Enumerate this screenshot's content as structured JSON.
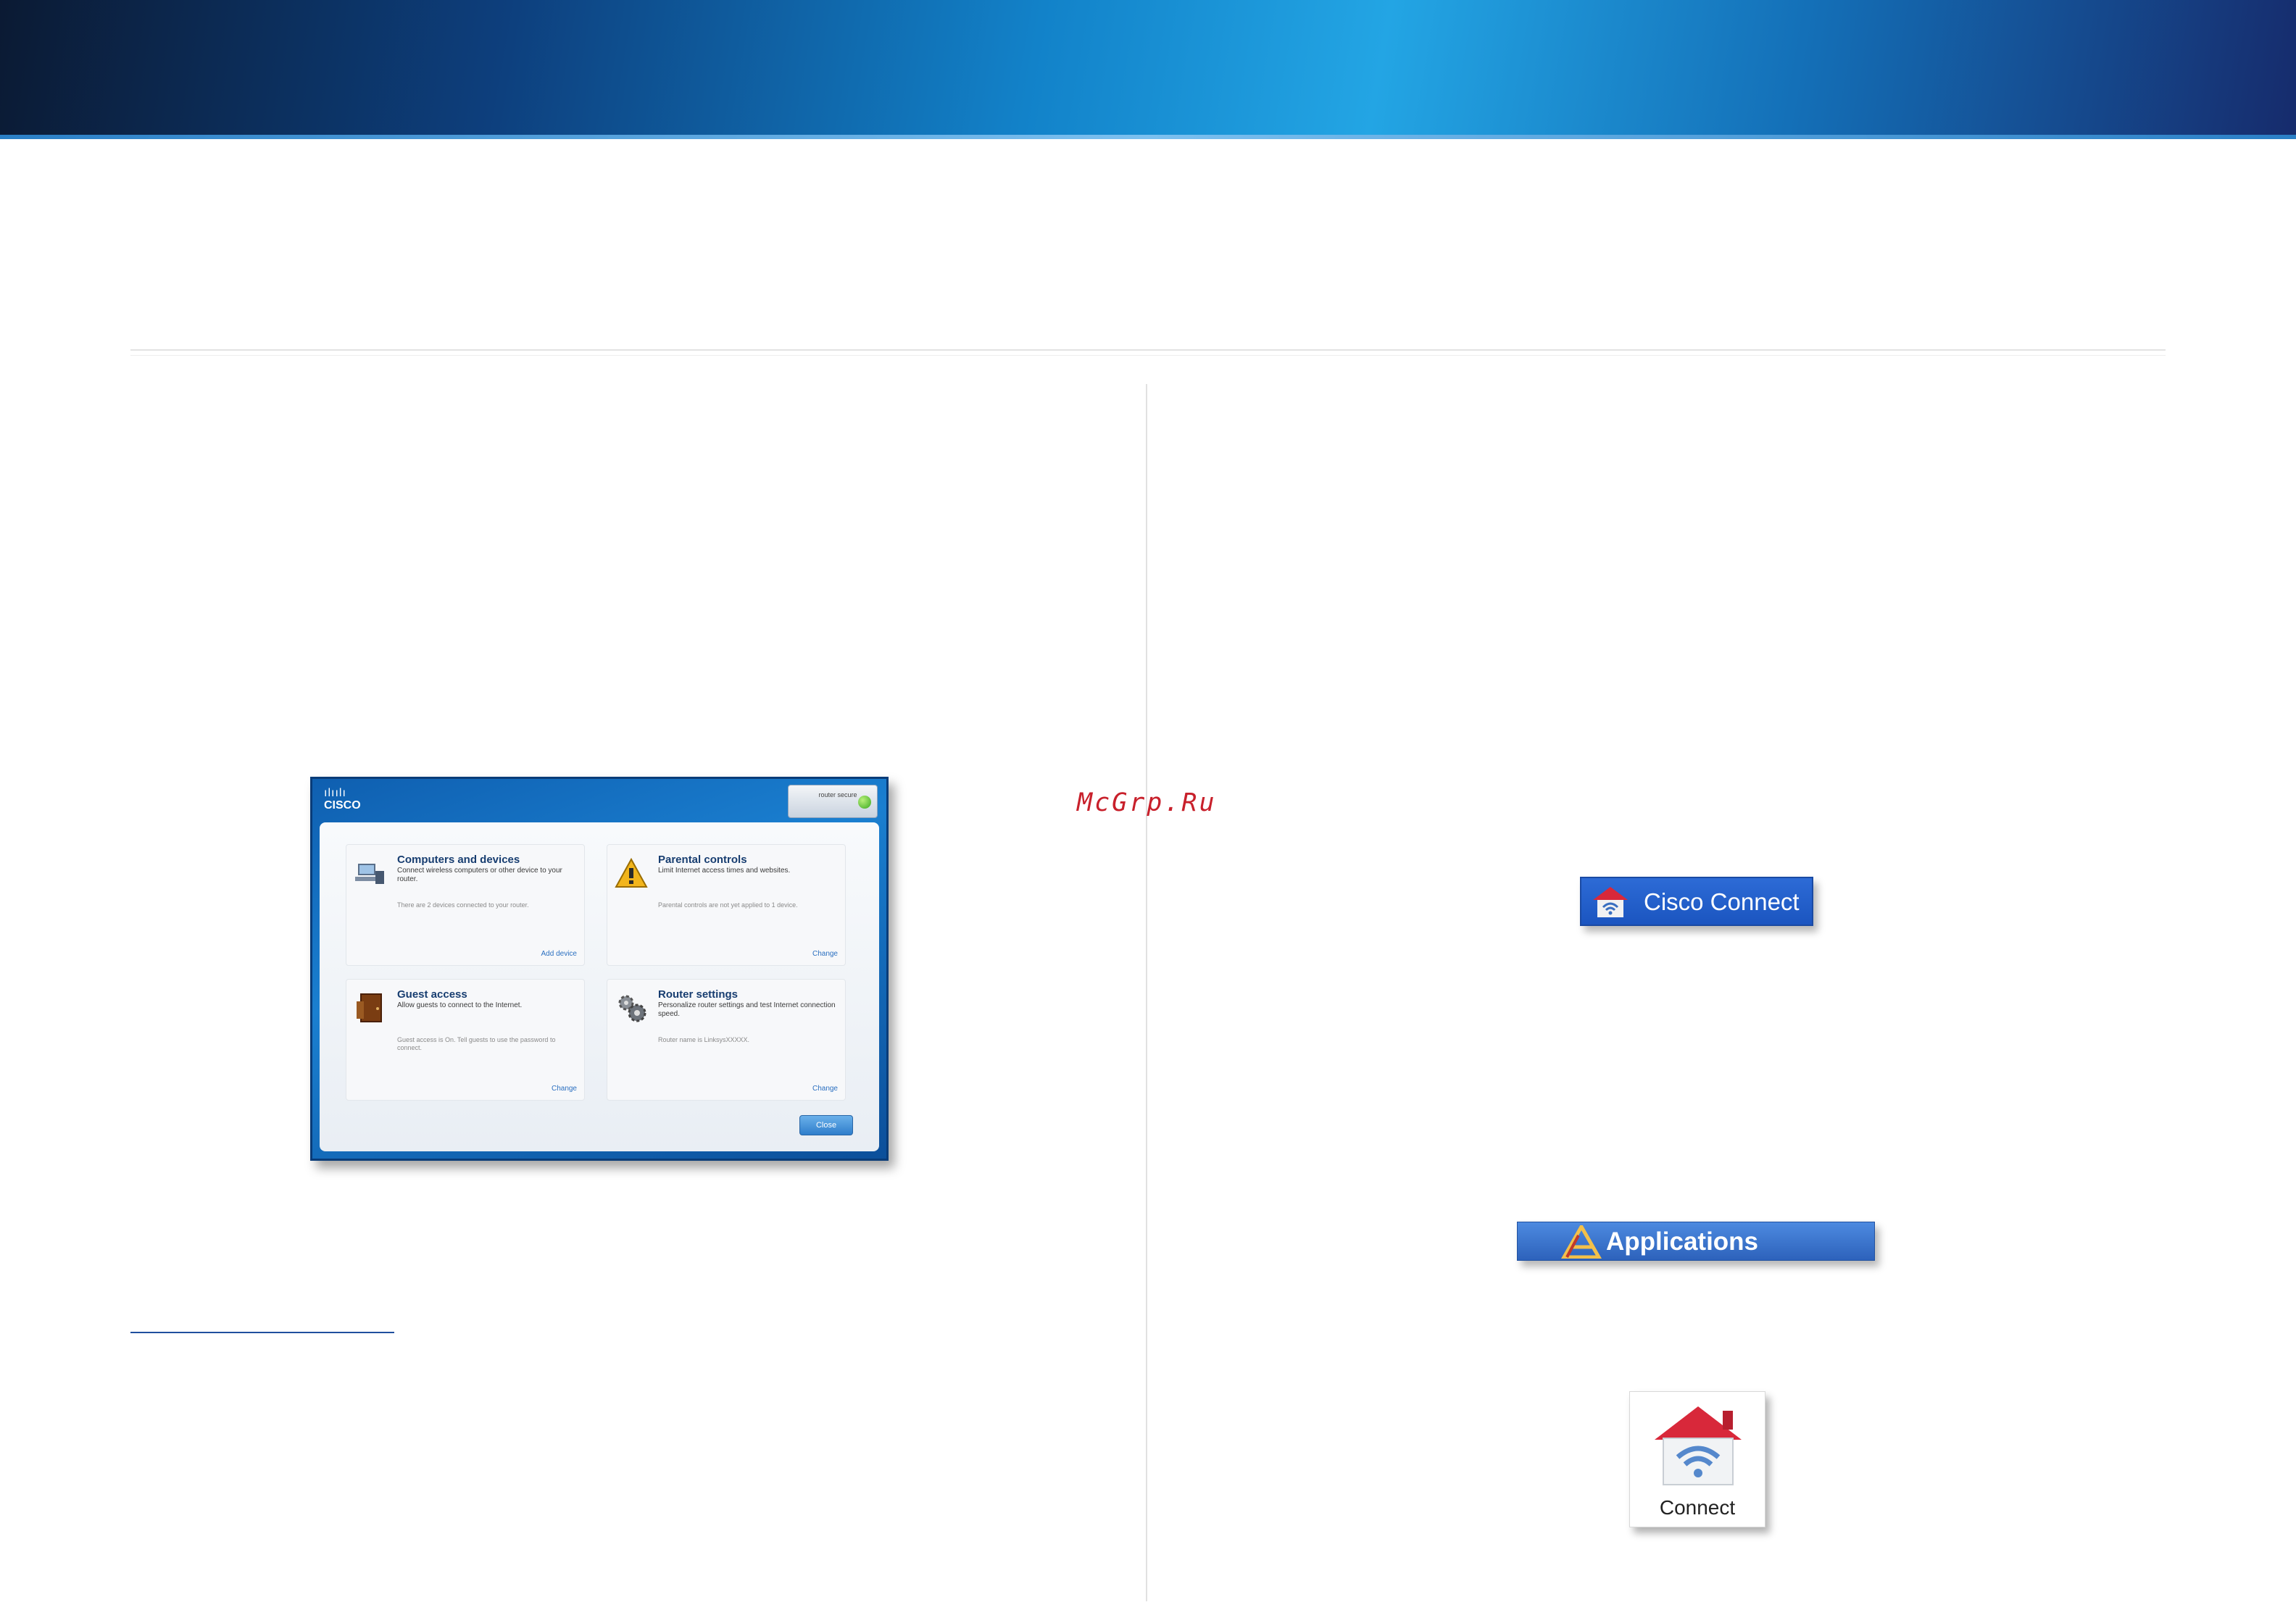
{
  "watermark": "McGrp.Ru",
  "dashboard": {
    "logo_bars": "ılıılı",
    "logo_word": "CISCO",
    "status_text": "router secure",
    "cards": [
      {
        "title": "Computers and devices",
        "desc": "Connect wireless computers or other device to your router.",
        "note": "There are 2 devices connected to your router.",
        "link": "Add device"
      },
      {
        "title": "Parental controls",
        "desc": "Limit Internet access times and websites.",
        "note": "Parental controls are not yet applied to 1 device.",
        "link": "Change"
      },
      {
        "title": "Guest access",
        "desc": "Allow guests to connect to the Internet.",
        "note": "Guest access is On. Tell guests to use the password to connect.",
        "link": "Change"
      },
      {
        "title": "Router settings",
        "desc": "Personalize router settings and test Internet connection speed.",
        "note": "Router name is LinksysXXXXX.",
        "link": "Change"
      }
    ],
    "close_label": "Close"
  },
  "cisco_connect_button": {
    "label": "Cisco Connect",
    "icon": "house-wifi-icon"
  },
  "applications_bar": {
    "label": "Applications",
    "icon": "applications-folder-icon"
  },
  "connect_tile": {
    "label": "Connect",
    "icon": "house-wifi-icon"
  },
  "colors": {
    "banner_dark": "#0b1a33",
    "banner_light": "#23a5e4",
    "accent_blue": "#1f4f9e",
    "watermark_red": "#c8202b"
  }
}
